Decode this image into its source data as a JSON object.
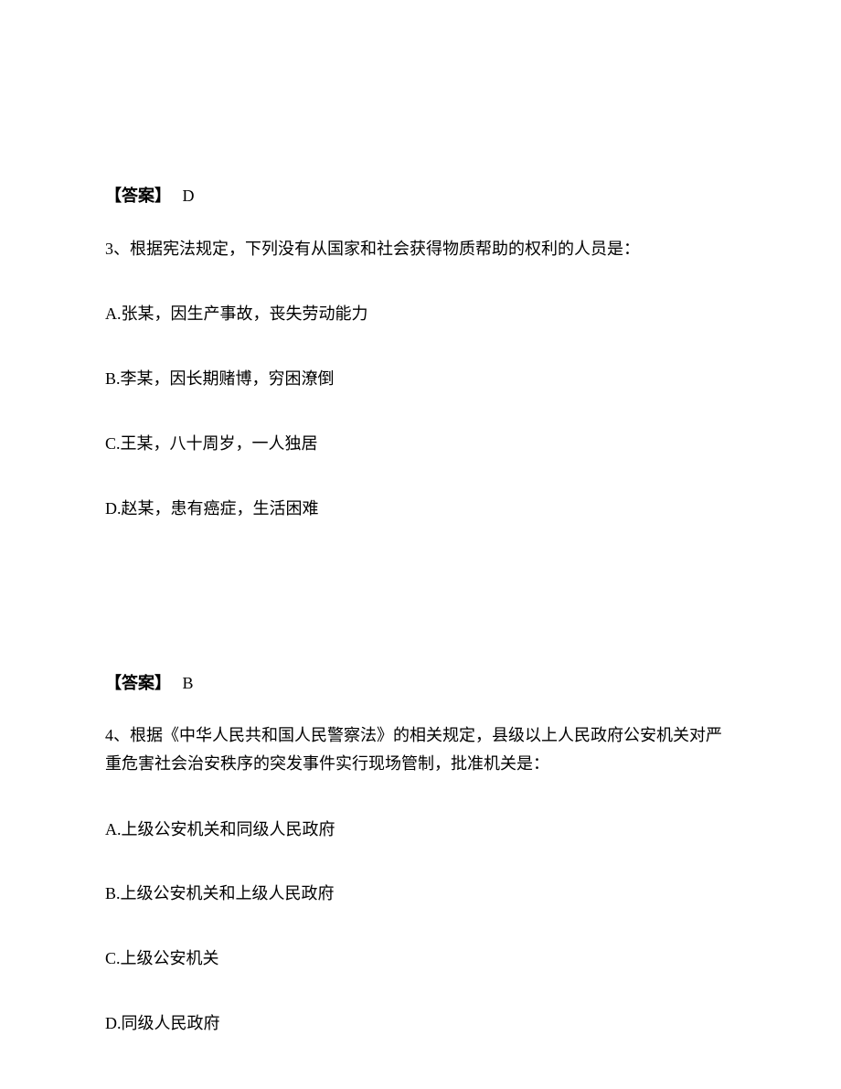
{
  "q2": {
    "answerLabel": "【答案】",
    "answerValue": "D"
  },
  "q3": {
    "stem": "3、根据宪法规定，下列没有从国家和社会获得物质帮助的权利的人员是：",
    "optionA": "A.张某，因生产事故，丧失劳动能力",
    "optionB": "B.李某，因长期赌博，穷困潦倒",
    "optionC": "C.王某，八十周岁，一人独居",
    "optionD": "D.赵某，患有癌症，生活困难",
    "answerLabel": "【答案】",
    "answerValue": "B"
  },
  "q4": {
    "stem": "4、根据《中华人民共和国人民警察法》的相关规定，县级以上人民政府公安机关对严重危害社会治安秩序的突发事件实行现场管制，批准机关是：",
    "optionA": "A.上级公安机关和同级人民政府",
    "optionB": "B.上级公安机关和上级人民政府",
    "optionC": "C.上级公安机关",
    "optionD": "D.同级人民政府"
  }
}
